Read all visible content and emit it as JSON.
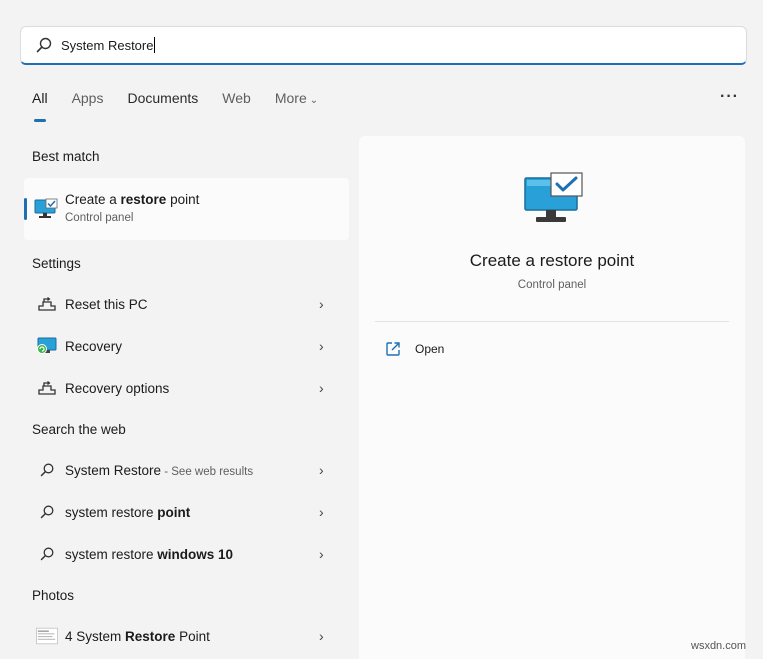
{
  "search": {
    "value": "System Restore"
  },
  "tabs": [
    {
      "label": "All"
    },
    {
      "label": "Apps"
    },
    {
      "label": "Documents"
    },
    {
      "label": "Web"
    },
    {
      "label": "More"
    }
  ],
  "sections": {
    "best_match": "Best match",
    "settings": "Settings",
    "search_web": "Search the web",
    "photos": "Photos"
  },
  "best_match": {
    "title_pre": "Create a ",
    "title_bold": "restore",
    "title_post": " point",
    "subtitle": "Control panel"
  },
  "settings_items": [
    {
      "label": "Reset this PC"
    },
    {
      "label": "Recovery"
    },
    {
      "label": "Recovery options"
    }
  ],
  "web_items": [
    {
      "pre": "System Restore",
      "suffix": " - See web results",
      "bold": ""
    },
    {
      "pre": "system restore ",
      "suffix": "",
      "bold": "point"
    },
    {
      "pre": "system restore ",
      "suffix": "",
      "bold": "windows 10"
    }
  ],
  "photos_items": [
    {
      "pre": "4 System ",
      "bold": "Restore",
      "post": " Point"
    }
  ],
  "detail": {
    "title": "Create a restore point",
    "subtitle": "Control panel",
    "open_label": "Open"
  },
  "watermark": "wsxdn.com",
  "colors": {
    "accent": "#1f6fb5",
    "background": "#f3f3f3",
    "panel": "#fbfbfb"
  }
}
